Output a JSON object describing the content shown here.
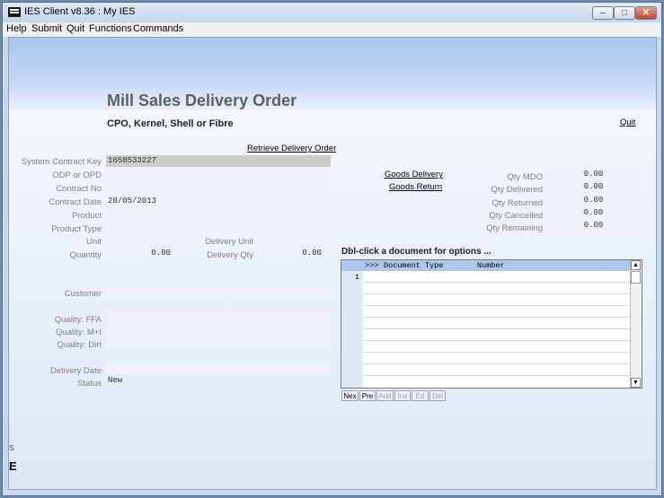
{
  "window": {
    "title": "IES Client v8.36 : My IES"
  },
  "menu": [
    "Help",
    "Submit",
    "Quit",
    "Functions",
    "Commands"
  ],
  "page": {
    "title": "Mill Sales Delivery Order",
    "subtitle": "CPO, Kernel, Shell or Fibre",
    "quit_link": "Quit",
    "retrieve_link": "Retrieve Delivery Order"
  },
  "form": {
    "system_contract_key": {
      "label": "System Contract Key",
      "value": "1658533227"
    },
    "odp_or_opd": {
      "label": "ODP or OPD",
      "value": ""
    },
    "contract_no": {
      "label": "Contract No",
      "value": ""
    },
    "contract_date": {
      "label": "Contract Date",
      "value": "28/05/2013"
    },
    "product": {
      "label": "Product",
      "value": ""
    },
    "product_type": {
      "label": "Product Type",
      "value": ""
    },
    "unit": {
      "label": "Unit",
      "value": ""
    },
    "quantity": {
      "label": "Quantity",
      "value": "0.00"
    },
    "delivery_unit": {
      "label": "Delivery Unit",
      "value": ""
    },
    "delivery_qty": {
      "label": "Delivery Qty",
      "value": "0.00"
    },
    "customer": {
      "label": "Customer",
      "value": ""
    },
    "quality_ffa": {
      "label": "Quality: FFA",
      "value": ""
    },
    "quality_mi": {
      "label": "Quality: M+I",
      "value": ""
    },
    "quality_dirt": {
      "label": "Quality: Dirt",
      "value": ""
    },
    "delivery_date": {
      "label": "Delivery Date",
      "value": ""
    },
    "status": {
      "label": "Status",
      "value": "New"
    }
  },
  "right": {
    "goods_delivery_link": "Goods Delivery",
    "goods_return_link": "Goods Return",
    "qty_mdo": {
      "label": "Qty MDO",
      "value": "0.00"
    },
    "qty_delivered": {
      "label": "Qty Delivered",
      "value": "0.00"
    },
    "qty_returned": {
      "label": "Qty Returned",
      "value": "0.00"
    },
    "qty_cancelled": {
      "label": "Qty Cancelled",
      "value": "0.00"
    },
    "qty_remaining": {
      "label": "Qty Remaining",
      "value": "0.00"
    }
  },
  "documents": {
    "heading": "Dbl-click a document for options ...",
    "header_marker": ">>>",
    "col_document_type": "Document Type",
    "col_number": "Number",
    "row_number": "1",
    "buttons": [
      "Nex",
      "Pre",
      "Add",
      "Ins",
      "Ed",
      "Del"
    ]
  },
  "side": {
    "ses": "Ses",
    "e": "E"
  }
}
